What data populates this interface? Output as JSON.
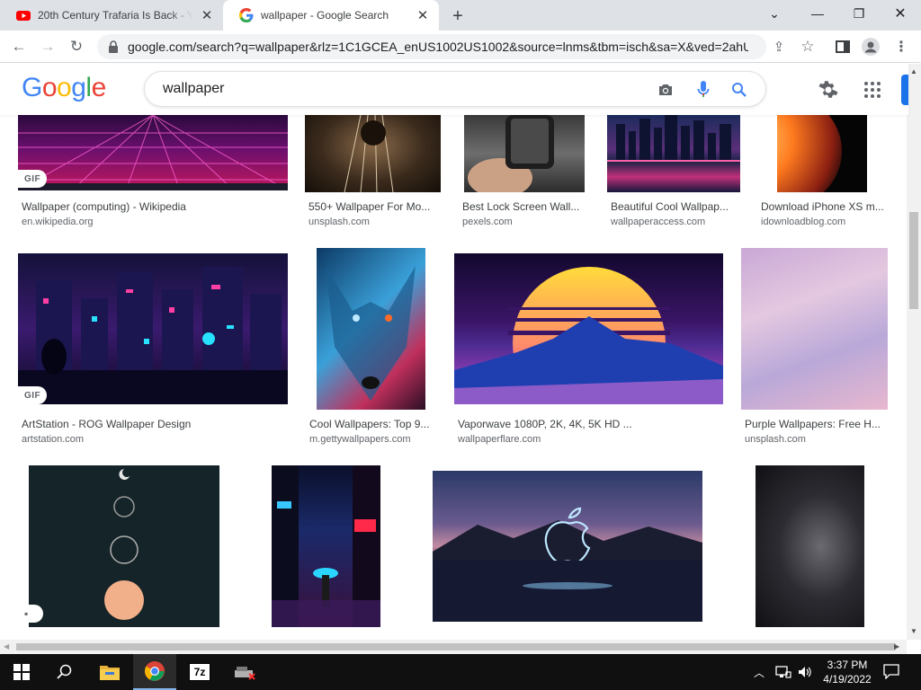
{
  "browser": {
    "tabs": [
      {
        "title": "20th Century Trafaria Is Back - Yo",
        "icon": "youtube-icon",
        "active": false
      },
      {
        "title": "wallpaper - Google Search",
        "icon": "google-icon",
        "active": true
      }
    ],
    "url": "google.com/search?q=wallpaper&rlz=1C1GCEA_enUS1002US1002&source=lnms&tbm=isch&sa=X&ved=2ahU..."
  },
  "google": {
    "logo_letters": [
      "G",
      "o",
      "o",
      "g",
      "l",
      "e"
    ],
    "query": "wallpaper"
  },
  "results": [
    {
      "caption": "Wallpaper (computing) - Wikipedia",
      "domain": "en.wikipedia.org",
      "badge": "GIF"
    },
    {
      "caption": "550+ Wallpaper For Mo...",
      "domain": "unsplash.com"
    },
    {
      "caption": "Best Lock Screen Wall...",
      "domain": "pexels.com"
    },
    {
      "caption": "Beautiful Cool Wallpap...",
      "domain": "wallpaperaccess.com"
    },
    {
      "caption": "Download iPhone XS m...",
      "domain": "idownloadblog.com"
    },
    {
      "caption": "ArtStation - ROG Wallpaper Design",
      "domain": "artstation.com",
      "badge": "GIF"
    },
    {
      "caption": "Cool Wallpapers: Top 9...",
      "domain": "m.gettywallpapers.com"
    },
    {
      "caption": "Vaporwave 1080P, 2K, 4K, 5K HD ...",
      "domain": "wallpaperflare.com"
    },
    {
      "caption": "Purple Wallpapers: Free H...",
      "domain": "unsplash.com"
    }
  ],
  "taskbar": {
    "time": "3:37 PM",
    "date": "4/19/2022"
  },
  "colors": {
    "google_blue": "#4285f4",
    "google_red": "#ea4335",
    "google_yellow": "#fbbc05",
    "google_green": "#34a853"
  }
}
